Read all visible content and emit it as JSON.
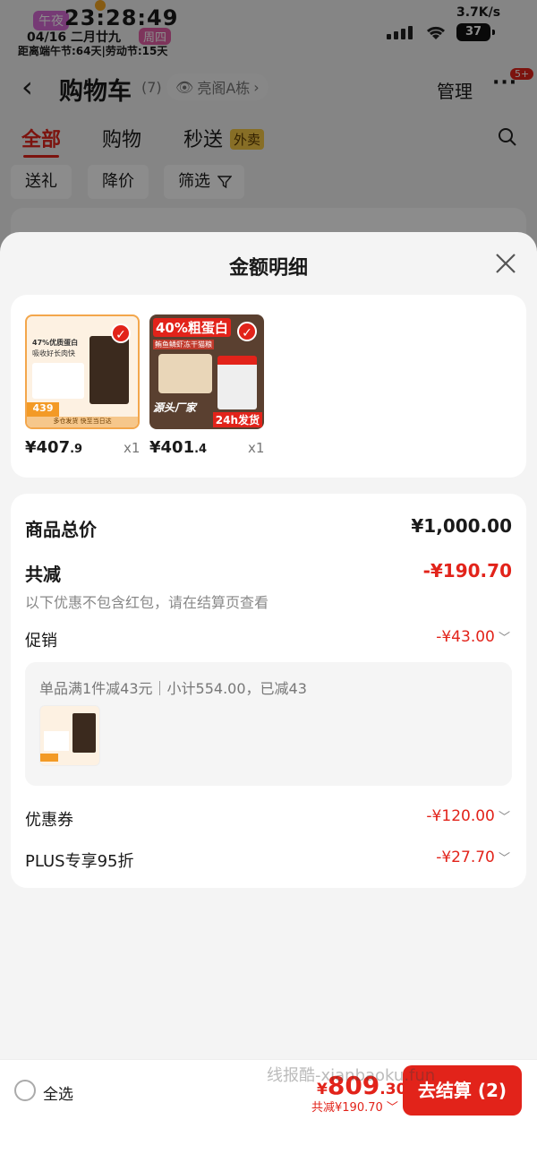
{
  "status_bar": {
    "period": "午夜",
    "time": "23:28:49",
    "date": "04/16 二月廿九",
    "weekday": "周四",
    "countdown": "距离端午节:64天|劳动节:15天",
    "net_speed": "3.7K/s",
    "battery": "37"
  },
  "header": {
    "title": "购物车",
    "count": "(7)",
    "address": "亮阁A栋",
    "manage": "管理",
    "more": "···",
    "badge": "5+"
  },
  "tabs": [
    {
      "label": "全部"
    },
    {
      "label": "购物"
    },
    {
      "label": "秒送"
    }
  ],
  "tab_tag": "外卖",
  "chips": [
    {
      "label": "送礼"
    },
    {
      "label": "降价"
    },
    {
      "label": "筛选"
    }
  ],
  "sheet": {
    "title": "金额明细",
    "products": [
      {
        "price_main": "¥407",
        "price_dec": ".9",
        "qty": "x1",
        "img_badge": "439",
        "img_title": "47%优质蛋白",
        "img_sub": "吸收好长肉快",
        "img_foot": "多仓发货 快至当日达"
      },
      {
        "price_main": "¥401",
        "price_dec": ".4",
        "qty": "x1",
        "img_badge": "24h发货",
        "img_title": "40%粗蛋白",
        "img_sub": "鲔鱼鳞虾冻干猫粮",
        "img_foot": "源头厂家"
      }
    ],
    "summary": {
      "total_label": "商品总价",
      "total_value": "¥1,000.00",
      "reduce_label": "共减",
      "reduce_value": "-¥190.70",
      "reduce_note": "以下优惠不包含红包，请在结算页查看",
      "promo_label": "促销",
      "promo_value": "-¥43.00",
      "promo_detail": "单品满1件减43元｜小计554.00，已减43",
      "coupon_label": "优惠券",
      "coupon_value": "-¥120.00",
      "plus_label": "PLUS专享95折",
      "plus_value": "-¥27.70"
    }
  },
  "bottom_bar": {
    "select_all": "全选",
    "yen": "¥",
    "total_int": "809",
    "total_dec": ".30",
    "total_reduce": "共减¥190.70",
    "checkout": "去结算 (2)",
    "watermark": "线报酷-xianbaoku.fun"
  },
  "colors": {
    "accent": "#e2231a",
    "sheet_bg": "#f4f4f4"
  }
}
